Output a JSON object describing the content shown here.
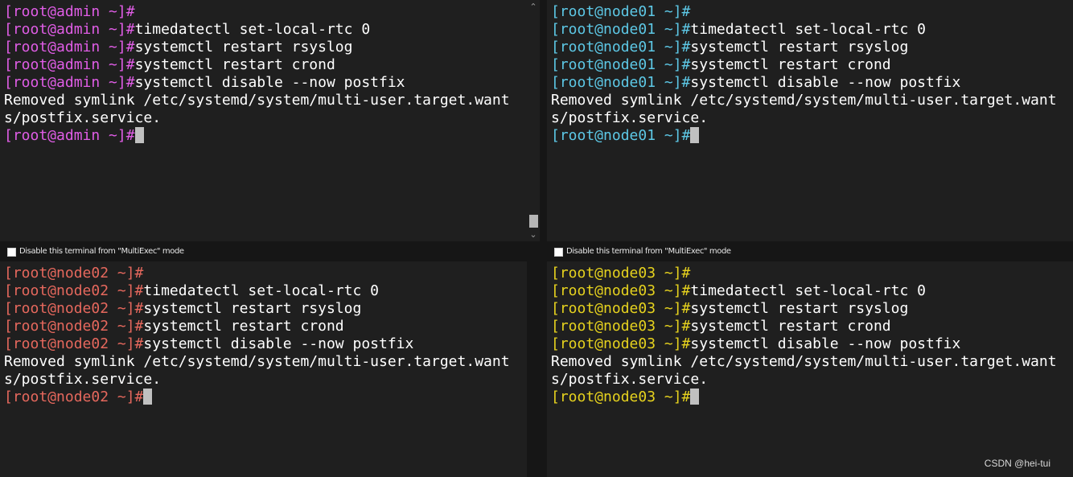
{
  "colors": {
    "admin_prompt": "#e05de6",
    "node01_prompt": "#5dc8e6",
    "node02_prompt": "#e6685d",
    "node03_prompt": "#e6d21e",
    "output_text": "#ffffff",
    "pane_bg": "#1f1f1f"
  },
  "terminals": [
    {
      "prompt": "[root@admin ~]#",
      "lines": [
        {
          "prompt": "[root@admin ~]#",
          "cmd": ""
        },
        {
          "prompt": "[root@admin ~]#",
          "cmd": "timedatectl set-local-rtc 0"
        },
        {
          "prompt": "[root@admin ~]#",
          "cmd": "systemctl restart rsyslog"
        },
        {
          "prompt": "[root@admin ~]#",
          "cmd": "systemctl restart crond"
        },
        {
          "prompt": "[root@admin ~]#",
          "cmd": "systemctl disable --now postfix"
        },
        {
          "prompt": "",
          "cmd": "Removed symlink /etc/systemd/system/multi-user.target.want"
        },
        {
          "prompt": "",
          "cmd": "s/postfix.service."
        },
        {
          "prompt": "[root@admin ~]#",
          "cmd": ""
        }
      ]
    },
    {
      "prompt": "[root@node01 ~]#",
      "lines": [
        {
          "prompt": "[root@node01 ~]#",
          "cmd": ""
        },
        {
          "prompt": "[root@node01 ~]#",
          "cmd": "timedatectl set-local-rtc 0"
        },
        {
          "prompt": "[root@node01 ~]#",
          "cmd": "systemctl restart rsyslog"
        },
        {
          "prompt": "[root@node01 ~]#",
          "cmd": "systemctl restart crond"
        },
        {
          "prompt": "[root@node01 ~]#",
          "cmd": "systemctl disable --now postfix"
        },
        {
          "prompt": "",
          "cmd": "Removed symlink /etc/systemd/system/multi-user.target.want"
        },
        {
          "prompt": "",
          "cmd": "s/postfix.service."
        },
        {
          "prompt": "[root@node01 ~]#",
          "cmd": ""
        }
      ]
    },
    {
      "prompt": "[root@node02 ~]#",
      "lines": [
        {
          "prompt": "[root@node02 ~]#",
          "cmd": ""
        },
        {
          "prompt": "[root@node02 ~]#",
          "cmd": "timedatectl set-local-rtc 0"
        },
        {
          "prompt": "[root@node02 ~]#",
          "cmd": "systemctl restart rsyslog"
        },
        {
          "prompt": "[root@node02 ~]#",
          "cmd": "systemctl restart crond"
        },
        {
          "prompt": "[root@node02 ~]#",
          "cmd": "systemctl disable --now postfix"
        },
        {
          "prompt": "",
          "cmd": "Removed symlink /etc/systemd/system/multi-user.target.want"
        },
        {
          "prompt": "",
          "cmd": "s/postfix.service."
        },
        {
          "prompt": "[root@node02 ~]#",
          "cmd": ""
        }
      ]
    },
    {
      "prompt": "[root@node03 ~]#",
      "lines": [
        {
          "prompt": "[root@node03 ~]#",
          "cmd": ""
        },
        {
          "prompt": "[root@node03 ~]#",
          "cmd": "timedatectl set-local-rtc 0"
        },
        {
          "prompt": "[root@node03 ~]#",
          "cmd": "systemctl restart rsyslog"
        },
        {
          "prompt": "[root@node03 ~]#",
          "cmd": "systemctl restart crond"
        },
        {
          "prompt": "[root@node03 ~]#",
          "cmd": "systemctl disable --now postfix"
        },
        {
          "prompt": "",
          "cmd": "Removed symlink /etc/systemd/system/multi-user.target.want"
        },
        {
          "prompt": "",
          "cmd": "s/postfix.service."
        },
        {
          "prompt": "[root@node03 ~]#",
          "cmd": ""
        }
      ]
    }
  ],
  "multiexec": {
    "label": "Disable this terminal from \"MultiExec\" mode"
  },
  "scrollbar": {
    "up_icon": "chevron-up-icon",
    "down_icon": "chevron-down-icon"
  },
  "watermark": "CSDN @hei-tui"
}
